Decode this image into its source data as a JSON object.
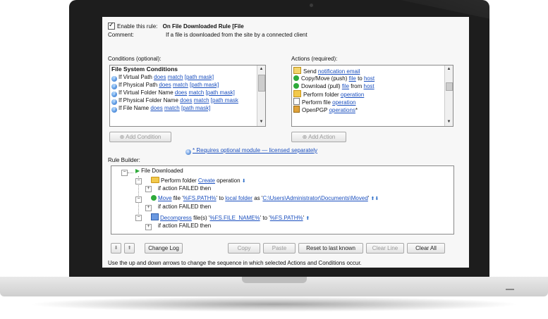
{
  "rule": {
    "enable_label": "Enable this rule:",
    "rule_name": "On File Downloaded Rule [File",
    "comment_label": "Comment:",
    "comment_value": "If a file is downloaded from the site by a connected client"
  },
  "conditions": {
    "heading": "Conditions (optional):",
    "group_title": "File System Conditions",
    "items": [
      {
        "prefix": "If Virtual Path",
        "op": "does",
        "op2": "match",
        "arg": "[path mask]"
      },
      {
        "prefix": "If Physical Path",
        "op": "does",
        "op2": "match",
        "arg": "[path mask]"
      },
      {
        "prefix": "If Virtual Folder Name",
        "op": "does",
        "op2": "match",
        "arg": "[path mask]"
      },
      {
        "prefix": "If Physical Folder Name",
        "op": "does",
        "op2": "match",
        "arg": "[path mask"
      },
      {
        "prefix": "If File Name",
        "op": "does",
        "op2": "match",
        "arg": "[path mask]"
      }
    ],
    "add_button": "Add Condition"
  },
  "actions": {
    "heading": "Actions (required):",
    "items": [
      {
        "icon": "envelope-icon",
        "text": "Send",
        "link": "notification email",
        "suffix": ""
      },
      {
        "icon": "upload-arrow-icon",
        "text": "Copy/Move (push)",
        "link": "file",
        "mid": "to",
        "link2": "host"
      },
      {
        "icon": "download-arrow-icon",
        "text": "Download (pull)",
        "link": "file",
        "mid": "from",
        "link2": "host"
      },
      {
        "icon": "folder-icon",
        "text": "Perform folder",
        "link": "operation",
        "suffix": ""
      },
      {
        "icon": "file-icon",
        "text": "Perform file",
        "link": "operation",
        "suffix": ""
      },
      {
        "icon": "lock-icon",
        "text": "OpenPGP",
        "link": "operations",
        "suffix": "*"
      }
    ],
    "add_button": "Add Action"
  },
  "licensing_note": "* Requires optional module — licensed separately",
  "rule_builder": {
    "heading": "Rule Builder:",
    "root": "File Downloaded",
    "node1_text": "Perform folder",
    "node1_link": "Create",
    "node1_suffix": "operation",
    "failed_text": "if action FAILED then",
    "node2_link": "Move",
    "node2_a": "file '",
    "node2_var1": "%FS.PATH%",
    "node2_b": "' to",
    "node2_link2": "local folder",
    "node2_c": "as '",
    "node2_path": "C:\\Users\\Administrator\\Documents\\Moved",
    "node2_d": "'",
    "node3_link": "Decompress",
    "node3_a": "file(s) '",
    "node3_var1": "%FS.FILE_NAME%",
    "node3_b": "' to '",
    "node3_var2": "%FS.PATH%",
    "node3_c": "'"
  },
  "buttons": {
    "change_log": "Change Log",
    "copy": "Copy",
    "paste": "Paste",
    "reset": "Reset to last known",
    "clear_line": "Clear Line",
    "clear_all": "Clear All"
  },
  "footer_hint": "Use the up and down arrows to change the sequence in which selected Actions and Conditions occur."
}
